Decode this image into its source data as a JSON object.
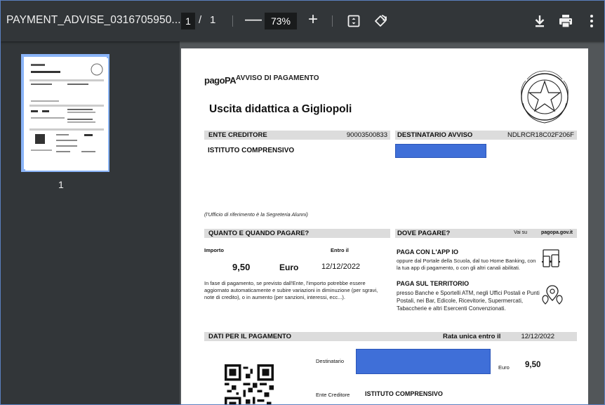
{
  "toolbar": {
    "filename": "PAYMENT_ADVISE_0316705950...",
    "current_page": "1",
    "page_separator": "/",
    "total_pages": "1",
    "zoom": "73%",
    "zoom_out_label": "—",
    "zoom_in_label": "+",
    "icons": [
      "fit-page-icon",
      "rotate-icon",
      "download-icon",
      "print-icon",
      "more-vert-icon"
    ]
  },
  "sidebar": {
    "thumbnails": [
      {
        "page_label": "1",
        "selected": true
      }
    ]
  },
  "document": {
    "logo_text": "pagoPA",
    "header_label": "AVVISO DI PAGAMENTO",
    "title": "Uscita didattica a Gigliopoli",
    "ente_creditore": {
      "heading": "ENTE CREDITORE",
      "code": "90003500833",
      "name": "ISTITUTO COMPRENSIVO"
    },
    "destinatario": {
      "heading": "DESTINATARIO AVVISO",
      "code": "NDLRCR18C02F206F"
    },
    "note_ufficio": "(l'Ufficio di riferimento è la Segreteria Alunni)",
    "quanto": {
      "heading": "QUANTO E QUANDO PAGARE?",
      "importo_label": "Importo",
      "entro_label": "Entro il",
      "amount": "9,50",
      "currency": "Euro",
      "due_date": "12/12/2022",
      "note": "In fase di pagamento, se previsto dall'Ente, l'importo potrebbe essere aggiornato automaticamente e subire variazioni in diminuzione (per sgravi, note di credito), o in aumento (per sanzioni, interessi, ecc...)."
    },
    "dove": {
      "heading": "DOVE PAGARE?",
      "link_prefix": "Vai su",
      "link": "pagopa.gov.it",
      "app_title": "PAGA CON L'APP IO",
      "app_text": "oppure dal Portale della Scuola, dal tuo Home Banking, con la tua app di pagamento, o con gli altri canali abilitati.",
      "territorio_title": "PAGA SUL TERRITORIO",
      "territorio_text": "presso Banche e Sportelli ATM, negli Uffici Postali e Punti Postali, nei Bar, Edicole, Ricevitorie, Supermercati, Tabaccherie e altri Esercenti Convenzionati."
    },
    "dati": {
      "heading": "DATI PER IL PAGAMENTO",
      "rata_label": "Rata unica entro il",
      "rata_date": "12/12/2022",
      "destinatario_label": "Destinatario",
      "euro_label": "Euro",
      "amount": "9,50",
      "ente_label": "Ente Creditore",
      "ente_name": "ISTITUTO COMPRENSIVO"
    }
  },
  "colors": {
    "toolbar_bg": "#323639",
    "viewer_bg": "#525659",
    "thumb_highlight": "#8ab4f8",
    "redaction": "#3f6fd8",
    "band_gray": "#dcdcdc"
  }
}
